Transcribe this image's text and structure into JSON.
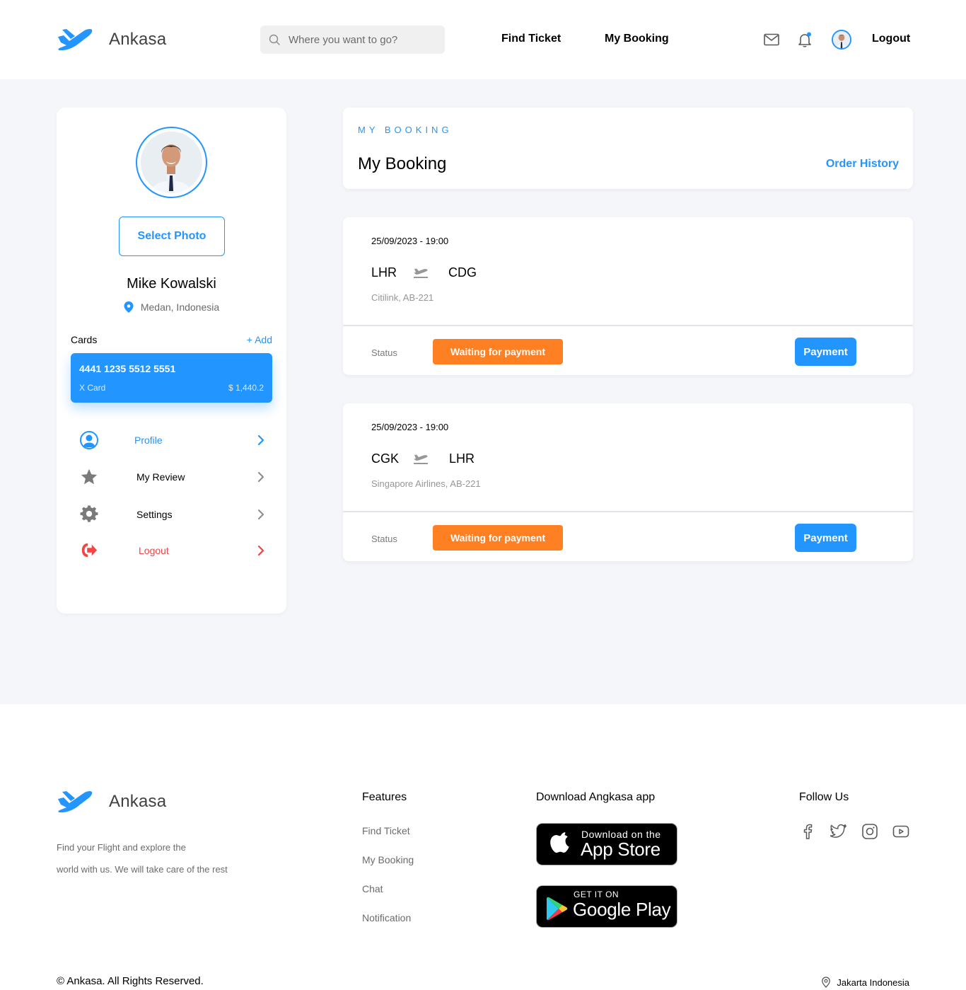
{
  "brand": {
    "name": "Ankasa",
    "color": "#2395ff"
  },
  "header": {
    "search_placeholder": "Where you want to go?",
    "nav": {
      "find_ticket": "Find Ticket",
      "my_booking": "My Booking"
    },
    "icons": [
      "mail-icon",
      "bell-icon",
      "avatar"
    ],
    "logout": "Logout"
  },
  "profile": {
    "select_photo": "Select Photo",
    "name": "Mike Kowalski",
    "location": "Medan, Indonesia",
    "cards_label": "Cards",
    "add_label": "+ Add",
    "card": {
      "number": "4441 1235 5512 5551",
      "type": "X Card",
      "balance": "$ 1,440.2"
    },
    "menu": [
      {
        "label": "Profile",
        "icon": "user-circle-icon",
        "color": "#2395ff"
      },
      {
        "label": "My Review",
        "icon": "star-icon",
        "color": "#000000"
      },
      {
        "label": "Settings",
        "icon": "gear-icon",
        "color": "#000000"
      },
      {
        "label": "Logout",
        "icon": "logout-icon",
        "color": "#f24545"
      }
    ]
  },
  "booking_header": {
    "eyebrow": "MY BOOKING",
    "title": "My Booking",
    "order_history": "Order History"
  },
  "bookings": [
    {
      "datetime": "25/09/2023 - 19:00",
      "from": "LHR",
      "to": "CDG",
      "airline": "Citilink, AB-221",
      "status_label": "Status",
      "status": "Waiting for payment",
      "action": "Payment"
    },
    {
      "datetime": "25/09/2023 - 19:00",
      "from": "CGK",
      "to": "LHR",
      "airline": "Singapore Airlines, AB-221",
      "status_label": "Status",
      "status": "Waiting for payment",
      "action": "Payment"
    }
  ],
  "footer": {
    "description_line1": "Find your Flight and explore the",
    "description_line2": "world with us. We will take care of the rest",
    "features_title": "Features",
    "features": [
      "Find Ticket",
      "My Booking",
      "Chat",
      "Notification"
    ],
    "download_title": "Download Angkasa app",
    "app_store": {
      "small": "Download on the",
      "big": "App Store"
    },
    "google_play": {
      "small": "GET IT ON",
      "big": "Google Play"
    },
    "follow_title": "Follow Us",
    "social": [
      "facebook-icon",
      "twitter-icon",
      "instagram-icon",
      "youtube-icon"
    ],
    "copyright": "© Ankasa. All Rights Reserved.",
    "location": "Jakarta Indonesia"
  },
  "colors": {
    "accent": "#2395ff",
    "warning": "#ff7f23",
    "danger": "#f24545",
    "background": "#f5f6fa"
  }
}
